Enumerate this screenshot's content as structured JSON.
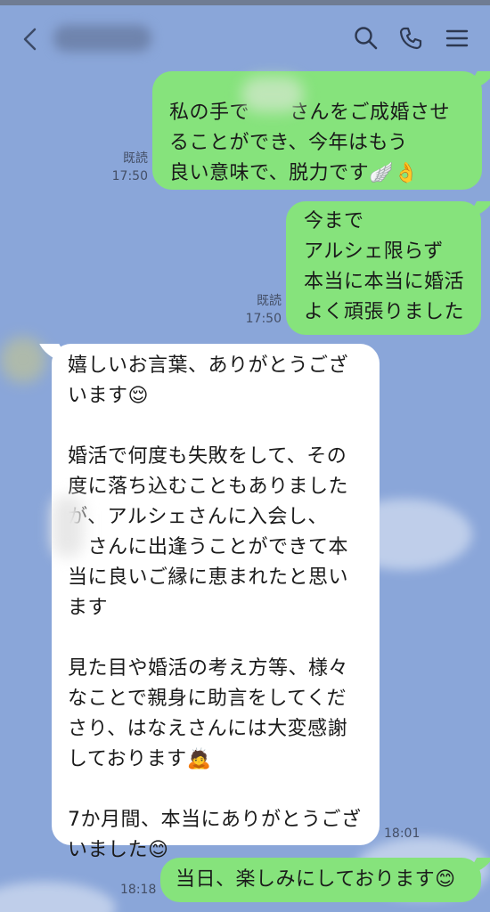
{
  "header": {
    "back_icon": "chevron-left-icon",
    "title": "",
    "search_icon": "search-icon",
    "phone_icon": "phone-icon",
    "menu_icon": "menu-icon"
  },
  "messages": [
    {
      "side": "right",
      "text": "私の手で　　さんをご成婚させ\nることができ、今年はもう\n良い意味で、脱力です🪽👌",
      "read": "既読",
      "time": "17:50"
    },
    {
      "side": "right",
      "text": "今まで\nアルシェ限らず\n本当に本当に婚活\nよく頑張りました",
      "read": "既読",
      "time": "17:50"
    },
    {
      "side": "left",
      "text": "嬉しいお言葉、ありがとうござ\nいます😌\n\n婚活で何度も失敗をして、その\n度に落ち込むこともありました\nが、アルシェさんに入会し、\n　さんに出逢うことができて本\n当に良いご縁に恵まれたと思い\nます\n\n見た目や婚活の考え方等、様々\nなことで親身に助言をしてくだ\nさり、はなえさんには大変感謝\nしております🙇\n\n7か月間、本当にありがとうござ\nいました😊",
      "time": "18:01"
    },
    {
      "side": "right",
      "text": "当日、楽しみにしております😊",
      "time": "18:18"
    }
  ],
  "colors": {
    "background": "#8aa6d9",
    "outgoing_bubble": "#86e37c",
    "incoming_bubble": "#ffffff"
  }
}
